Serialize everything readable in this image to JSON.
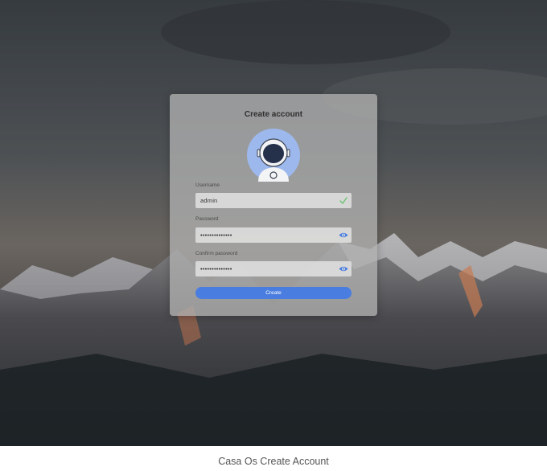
{
  "dialog": {
    "title": "Create account"
  },
  "form": {
    "username_label": "Username",
    "username_value": "admin",
    "password_label": "Password",
    "password_value": "••••••••••••••",
    "confirm_label": "Confirm password",
    "confirm_value": "••••••••••••••",
    "create_label": "Create"
  },
  "icons": {
    "avatar": "astronaut-avatar-icon",
    "username_status": "check-icon",
    "password_toggle": "eye-icon",
    "confirm_toggle": "eye-icon"
  },
  "colors": {
    "accent": "#4a7de0",
    "check": "#6cc36f",
    "avatar_bg": "#9db8ec"
  },
  "caption": "Casa Os Create Account"
}
